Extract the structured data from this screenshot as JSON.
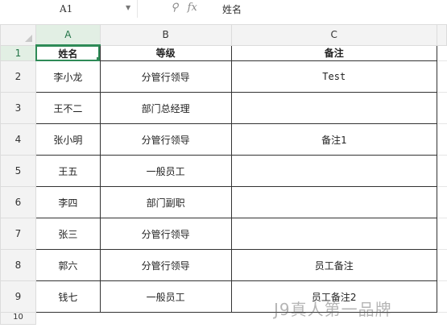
{
  "formula_bar": {
    "name_box": "A1",
    "zoom_icon": "magnifier-icon",
    "fx_icon": "fx-icon",
    "value": "姓名"
  },
  "grid": {
    "columns": [
      "A",
      "B",
      "C"
    ],
    "header_row_number": "1",
    "headers": [
      "姓名",
      "等级",
      "备注"
    ],
    "rows": [
      {
        "num": "2",
        "name": "李小龙",
        "level": "分管行领导",
        "note": "Test"
      },
      {
        "num": "3",
        "name": "王不二",
        "level": "部门总经理",
        "note": ""
      },
      {
        "num": "4",
        "name": "张小明",
        "level": "分管行领导",
        "note": "备注1"
      },
      {
        "num": "5",
        "name": "王五",
        "level": "一般员工",
        "note": ""
      },
      {
        "num": "6",
        "name": "李四",
        "level": "部门副职",
        "note": ""
      },
      {
        "num": "7",
        "name": "张三",
        "level": "分管行领导",
        "note": ""
      },
      {
        "num": "8",
        "name": "郭六",
        "level": "分管行领导",
        "note": "员工备注"
      },
      {
        "num": "9",
        "name": "钱七",
        "level": "一般员工",
        "note": "员工备注2"
      }
    ],
    "next_row_number": "10"
  },
  "watermark": "J9真人第一品牌",
  "colors": {
    "accent": "#2e8b57",
    "header_bg": "#f3f3f3"
  }
}
